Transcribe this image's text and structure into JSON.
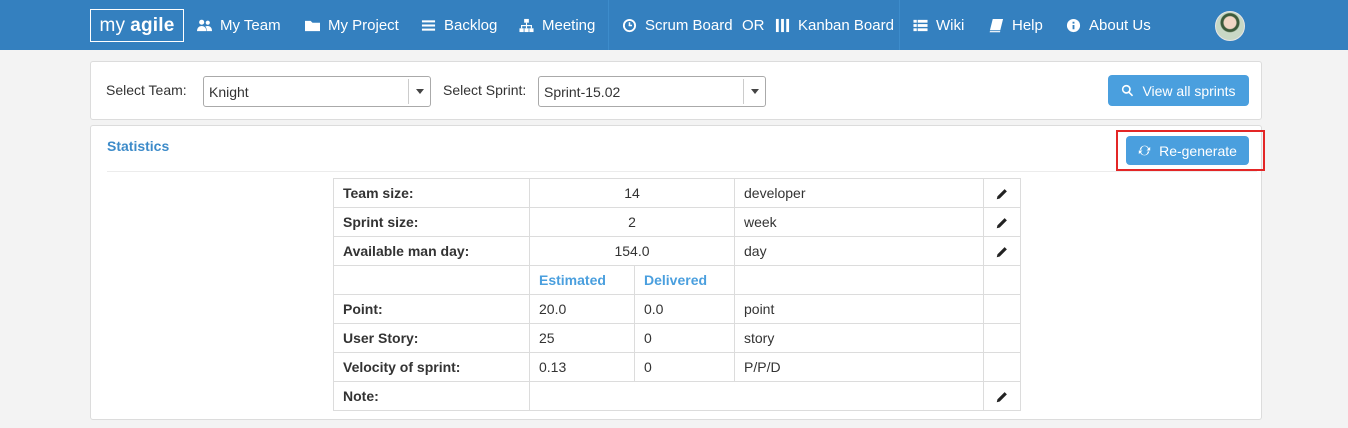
{
  "brand": {
    "prefix": "my",
    "name": "agile"
  },
  "nav": {
    "my_team": "My Team",
    "my_project": "My Project",
    "backlog": "Backlog",
    "meeting": "Meeting",
    "scrum_board": "Scrum Board",
    "or": "OR",
    "kanban_board": "Kanban Board",
    "wiki": "Wiki",
    "help": "Help",
    "about_us": "About Us"
  },
  "filter": {
    "team_label": "Select Team:",
    "team_value": "Knight",
    "sprint_label": "Select Sprint:",
    "sprint_value": "Sprint-15.02",
    "view_all_label": "View all sprints"
  },
  "statistics": {
    "title": "Statistics",
    "regenerate_label": "Re-generate",
    "team_size": {
      "label": "Team size:",
      "value": "14",
      "unit": "developer"
    },
    "sprint_size": {
      "label": "Sprint size:",
      "value": "2",
      "unit": "week"
    },
    "available_man_day": {
      "label": "Available man day:",
      "value": "154.0",
      "unit": "day"
    },
    "headers": {
      "estimated": "Estimated",
      "delivered": "Delivered"
    },
    "point": {
      "label": "Point:",
      "estimated": "20.0",
      "delivered": "0.0",
      "unit": "point"
    },
    "user_story": {
      "label": "User Story:",
      "estimated": "25",
      "delivered": "0",
      "unit": "story"
    },
    "velocity": {
      "label": "Velocity of sprint:",
      "estimated": "0.13",
      "delivered": "0",
      "unit": "P/P/D"
    },
    "note": {
      "label": "Note:",
      "value": ""
    }
  },
  "colors": {
    "navbar": "#3480bf",
    "accent": "#4a9fde",
    "highlight": "#e32626"
  }
}
